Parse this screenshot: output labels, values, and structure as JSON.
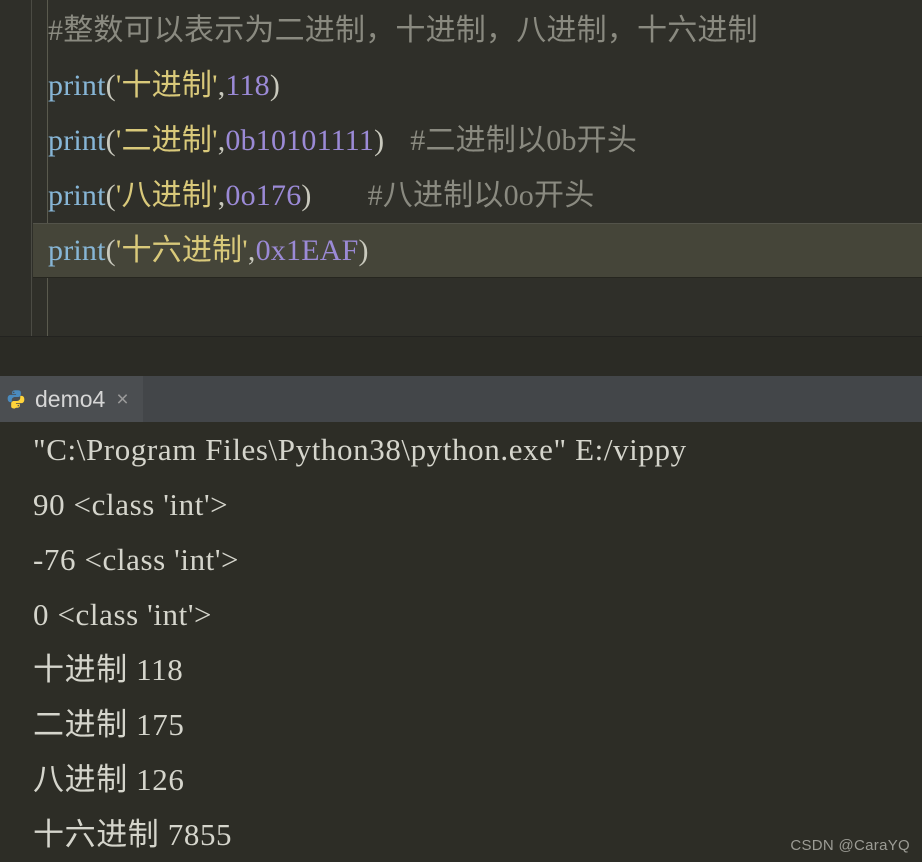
{
  "editor": {
    "lines": [
      {
        "type": "comment",
        "text": "#整数可以表示为二进制，十进制，八进制，十六进制",
        "highlight": false
      },
      {
        "type": "code",
        "func": "print",
        "open": "(",
        "string": "'十进制'",
        "comma": ",",
        "number": "118",
        "close": ")",
        "comment": "",
        "highlight": false
      },
      {
        "type": "code",
        "func": "print",
        "open": "(",
        "string": "'二进制'",
        "comma": ",",
        "number": "0b10101111",
        "close": ")",
        "comment": "#二进制以0b开头",
        "highlight": false
      },
      {
        "type": "code",
        "func": "print",
        "open": "(",
        "string": "'八进制'",
        "comma": ",",
        "number": "0o176",
        "close": ")",
        "comment": "#八进制以0o开头",
        "highlight": false
      },
      {
        "type": "code",
        "func": "print",
        "open": "(",
        "string": "'十六进制'",
        "comma": ",",
        "number": "0x1EAF",
        "close": ")",
        "comment": "",
        "highlight": true
      }
    ],
    "colors": {
      "background": "#2f2f29",
      "highlight_row": "#454539",
      "comment": "#8a8a80",
      "function": "#87b6d6",
      "string": "#d9c97a",
      "number": "#9b8ad6",
      "punctuation": "#c9c9bd"
    }
  },
  "console": {
    "tab": {
      "icon": "python-icon",
      "label": "demo4",
      "close": "×"
    },
    "background": "#2d2d26",
    "tabbar_background": "#434649",
    "output": [
      "\"C:\\Program Files\\Python38\\python.exe\" E:/vippy",
      "90 <class 'int'>",
      "-76 <class 'int'>",
      "0 <class 'int'>",
      "十进制 118",
      "二进制 175",
      "八进制 126",
      "十六进制 7855"
    ]
  },
  "watermark": {
    "text": "CSDN @CaraYQ"
  }
}
